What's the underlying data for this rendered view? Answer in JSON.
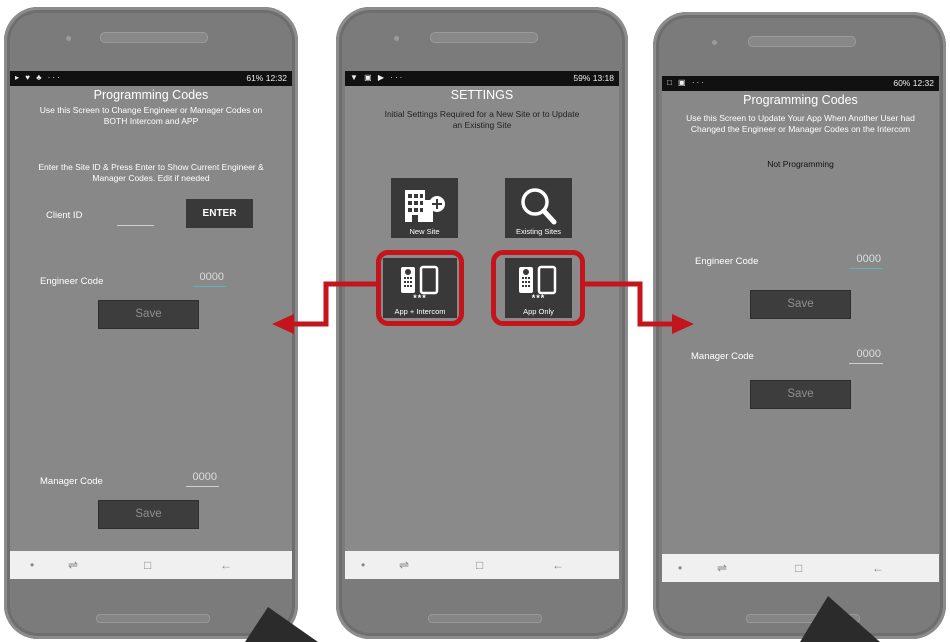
{
  "left_phone": {
    "status_left": "▸ ♥ ♣ ···",
    "status_right": "61% 12:32",
    "title": "Programming Codes",
    "subtitle_line1": "Use this Screen to Change Engineer or Manager Codes on",
    "subtitle_line2": "BOTH Intercom and APP",
    "instr_line1": "Enter the Site ID & Press Enter to Show Current Engineer &",
    "instr_line2": "Manager Codes. Edit if needed",
    "client_id_label": "Client ID",
    "client_id_value": "",
    "enter_label": "ENTER",
    "engineer_label": "Engineer Code",
    "engineer_value": "0000",
    "save_label": "Save",
    "manager_label": "Manager Code",
    "manager_value": "0000",
    "save2_label": "Save"
  },
  "middle_phone": {
    "status_left": "▼ ▣ ▶ ···",
    "status_right": "59% 13:18",
    "title": "SETTINGS",
    "subtitle_line1": "Initial Settings Required for a New Site or to Update",
    "subtitle_line2": "an Existing Site",
    "tiles": [
      {
        "label": "New Site",
        "icon": "building-plus-icon"
      },
      {
        "label": "Existing Sites",
        "icon": "magnifier-icon"
      },
      {
        "label": "App + Intercom",
        "icon": "intercom-phone-icon"
      },
      {
        "label": "App Only",
        "icon": "intercom-phone-icon"
      }
    ],
    "stars": "***"
  },
  "right_phone": {
    "status_left": "□ ▣ ···",
    "status_right": "60% 12:32",
    "title": "Programming Codes",
    "subtitle_line1": "Use this Screen to Update Your App When Another User had",
    "subtitle_line2": "Changed the Engineer or Manager Codes on the Intercom",
    "status_text": "Not Programming",
    "engineer_label": "Engineer Code",
    "engineer_value": "0000",
    "save_label": "Save",
    "manager_label": "Manager Code",
    "manager_value": "0000",
    "save2_label": "Save"
  },
  "colors": {
    "accent_red": "#c3151b",
    "screen_gray": "#888888",
    "button_dark": "#393939"
  }
}
